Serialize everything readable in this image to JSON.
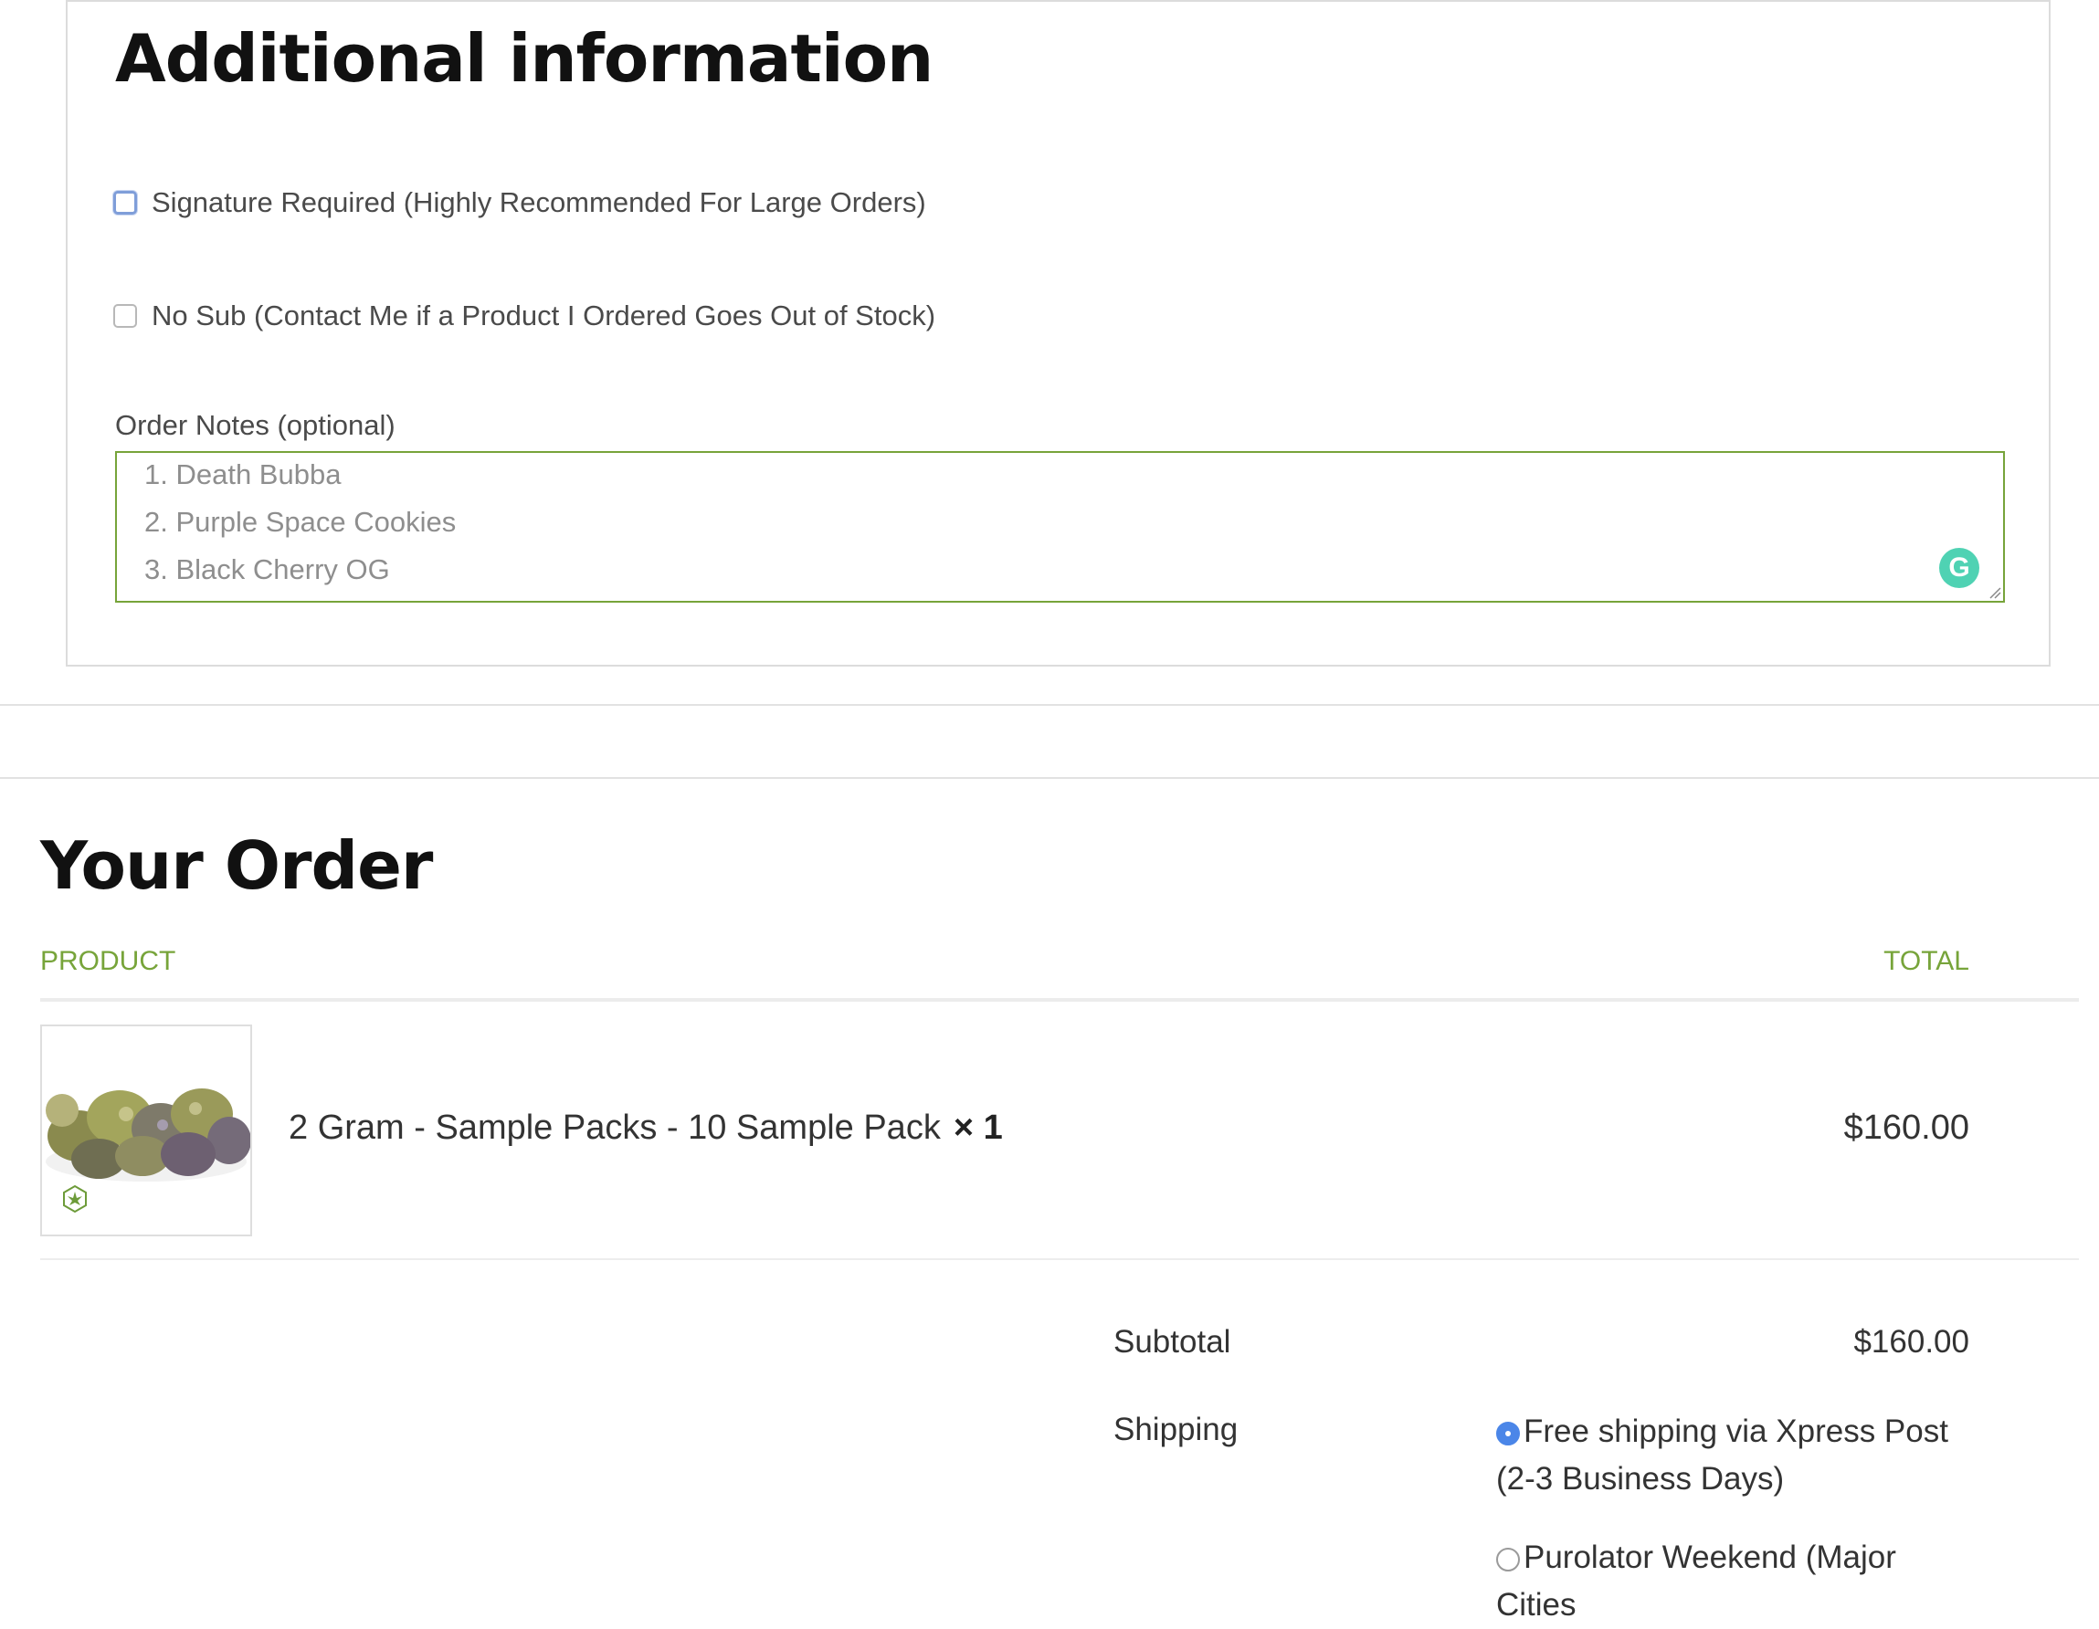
{
  "additional_info": {
    "title": "Additional information",
    "signature_label": "Signature Required (Highly Recommended For Large Orders)",
    "nosub_label": "No Sub (Contact Me if a Product I Ordered Goes Out of Stock)",
    "notes_label": "Order Notes (optional)",
    "notes_lines": [
      "1. Death Bubba",
      "2. Purple Space Cookies",
      "3. Black Cherry OG"
    ]
  },
  "order": {
    "title": "Your Order",
    "col_product": "PRODUCT",
    "col_total": "TOTAL",
    "item": {
      "name": "2 Gram - Sample Packs - 10 Sample Pack",
      "qty": "× 1",
      "total": "$160.00"
    },
    "subtotal_label": "Subtotal",
    "subtotal_value": "$160.00",
    "shipping_label": "Shipping",
    "shipping_options": [
      "Free shipping via Xpress Post (2-3 Business Days)",
      "Purolator Weekend (Major Cities"
    ]
  },
  "colors": {
    "accent_green": "#77a43a",
    "radio_blue": "#4b86e8",
    "grammarly": "#15c39a"
  },
  "icons": {
    "grammarly": "grammarly-icon",
    "resize": "resize-handle-icon"
  }
}
